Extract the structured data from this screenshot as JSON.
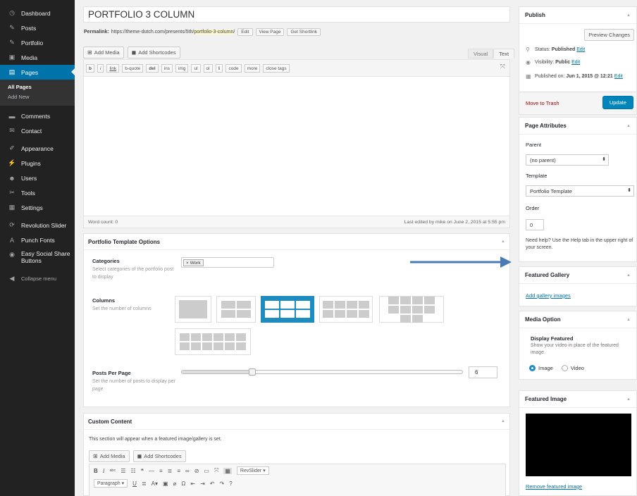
{
  "sidebar": {
    "items": [
      {
        "label": "Dashboard",
        "icon": "dashboard-icon",
        "glyph": "◷"
      },
      {
        "label": "Posts",
        "icon": "pin-icon",
        "glyph": "✎"
      },
      {
        "label": "Portfolio",
        "icon": "pin-icon",
        "glyph": "✎"
      },
      {
        "label": "Media",
        "icon": "media-icon",
        "glyph": "▣"
      },
      {
        "label": "Pages",
        "icon": "pages-icon",
        "glyph": "▤"
      },
      {
        "label": "Comments",
        "icon": "comment-icon",
        "glyph": "▬"
      },
      {
        "label": "Contact",
        "icon": "mail-icon",
        "glyph": "✉"
      },
      {
        "label": "Appearance",
        "icon": "brush-icon",
        "glyph": "✐"
      },
      {
        "label": "Plugins",
        "icon": "plug-icon",
        "glyph": "⚡"
      },
      {
        "label": "Users",
        "icon": "user-icon",
        "glyph": "☻"
      },
      {
        "label": "Tools",
        "icon": "wrench-icon",
        "glyph": "✂"
      },
      {
        "label": "Settings",
        "icon": "settings-icon",
        "glyph": "▦"
      },
      {
        "label": "Revolution Slider",
        "icon": "refresh-icon",
        "glyph": "⟳"
      },
      {
        "label": "Punch Fonts",
        "icon": "font-icon",
        "glyph": "A"
      },
      {
        "label": "Easy Social Share Buttons",
        "label_line1": "Easy Social Share",
        "label_line2": "Buttons",
        "icon": "share-icon",
        "glyph": "◉"
      },
      {
        "label": "Collapse menu",
        "icon": "collapse-icon",
        "glyph": "◀"
      }
    ],
    "submenu": [
      "All Pages",
      "Add New"
    ]
  },
  "editor": {
    "title": "PORTFOLIO 3 COLUMN",
    "permalink_label": "Permalink:",
    "permalink_base": "https://theme-dutch.com/presents/5th/",
    "permalink_slug": "portfolio-3-column",
    "permalink_end": "/",
    "edit_btn": "Edit",
    "view_btn": "View Page",
    "shortlink_btn": "Get Shortlink",
    "add_media": "Add Media",
    "add_shortcodes": "Add Shortcodes",
    "tab_visual": "Visual",
    "tab_text": "Text",
    "qtags": [
      "b",
      "i",
      "link",
      "b-quote",
      "del",
      "ins",
      "img",
      "ul",
      "ol",
      "li",
      "code",
      "more",
      "close tags"
    ],
    "word_count": "Word count: 0",
    "last_edited": "Last edited by mike on June 2, 2015 at 5:55 pm"
  },
  "portfolio_options": {
    "title": "Portfolio Template Options",
    "categories_label": "Categories",
    "categories_desc": "Select categories of the portfolio post to display",
    "category_token": "× Work",
    "columns_label": "Columns",
    "columns_desc": "Set the number of columns",
    "columns_selected": 3,
    "posts_label": "Posts Per Page",
    "posts_desc": "Set the number of posts to display per page",
    "posts_value": "6",
    "posts_fraction": 0.25
  },
  "custom_content": {
    "title": "Custom Content",
    "desc": "This section will appear when a featured image/gallery is set.",
    "add_media": "Add Media",
    "add_shortcodes": "Add Shortcodes",
    "revslider": "RevSlider ▾",
    "paragraph": "Paragraph ▾"
  },
  "publish": {
    "title": "Publish",
    "preview": "Preview Changes",
    "status_label": "Status:",
    "status_value": "Published",
    "visibility_label": "Visibility:",
    "visibility_value": "Public",
    "published_label": "Published on:",
    "published_value": "Jun 1, 2015 @ 12:21",
    "edit": "Edit",
    "trash": "Move to Trash",
    "update": "Update"
  },
  "page_attributes": {
    "title": "Page Attributes",
    "parent_label": "Parent",
    "parent_value": "(no parent)",
    "template_label": "Template",
    "template_value": "Portfolio Template",
    "order_label": "Order",
    "order_value": "0",
    "help": "Need help? Use the Help tab in the upper right of your screen."
  },
  "featured_gallery": {
    "title": "Featured Gallery",
    "link": "Add gallery images"
  },
  "media_option": {
    "title": "Media Option",
    "display_title": "Display Featured",
    "display_desc": "Show your video in place of the featured image.",
    "opt_image": "Image",
    "opt_video": "Video",
    "selected": "Image"
  },
  "featured_image": {
    "title": "Featured Image",
    "link": "Remove featured image"
  },
  "colors": {
    "accent": "#0073aa",
    "sidebar": "#222222",
    "arrow": "#4a7bb7"
  }
}
